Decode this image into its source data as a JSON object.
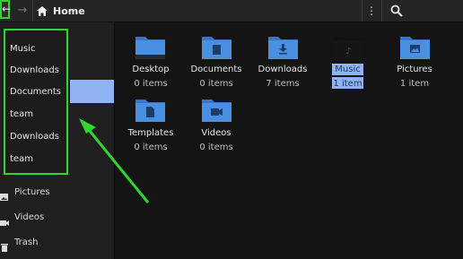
{
  "header": {
    "location": "Home"
  },
  "popup_menu": {
    "items": [
      "Music",
      "Downloads",
      "Documents",
      "team",
      "Downloads",
      "team"
    ]
  },
  "sidebar": {
    "items": [
      {
        "label": "Pictures",
        "icon": "picture-icon"
      },
      {
        "label": "Videos",
        "icon": "video-icon"
      },
      {
        "label": "Trash",
        "icon": "trash-icon"
      }
    ]
  },
  "files": [
    {
      "name": "Desktop",
      "count": "0 items",
      "icon": "desktop-folder-icon"
    },
    {
      "name": "Documents",
      "count": "0 items",
      "icon": "documents-folder-icon"
    },
    {
      "name": "Downloads",
      "count": "7 items",
      "icon": "downloads-folder-icon"
    },
    {
      "name": "Music",
      "count": "1 item",
      "icon": "music-folder-icon",
      "selected": true
    },
    {
      "name": "Pictures",
      "count": "1 item",
      "icon": "pictures-folder-icon"
    },
    {
      "name": "Templates",
      "count": "0 items",
      "icon": "templates-folder-icon"
    },
    {
      "name": "Videos",
      "count": "0 items",
      "icon": "videos-folder-icon"
    }
  ],
  "colors": {
    "folder": "#4a90e2",
    "selection": "#8fb3f5",
    "annotation": "#2fd62f"
  }
}
